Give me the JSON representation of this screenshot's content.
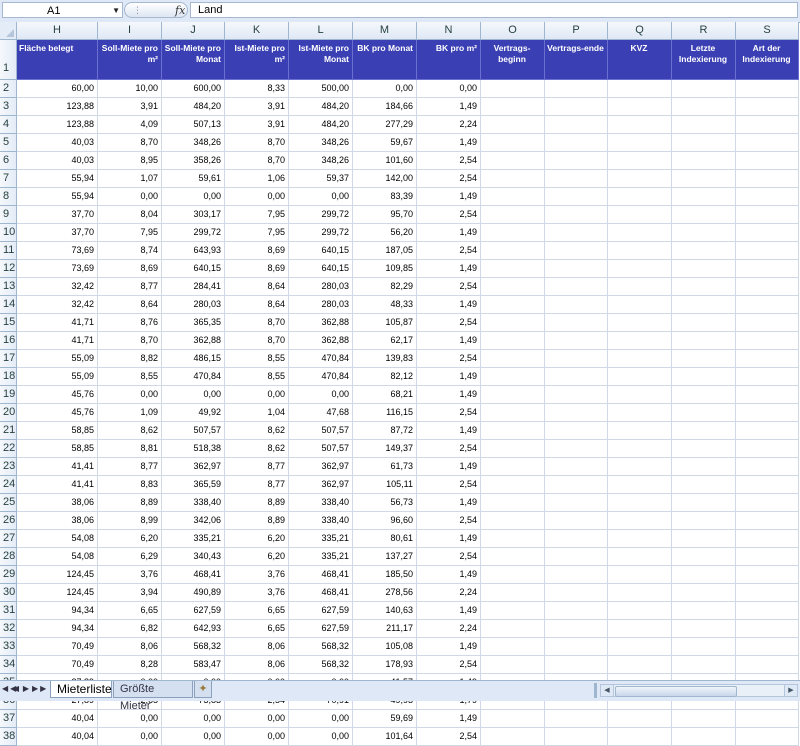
{
  "formula_bar": {
    "name_box": "A1",
    "fx_label": "fx",
    "formula_value": "Land"
  },
  "columns": [
    "H",
    "I",
    "J",
    "K",
    "L",
    "M",
    "N",
    "O",
    "P",
    "Q",
    "R",
    "S"
  ],
  "headers": [
    "Fläche belegt",
    "Soll-Miete pro m²",
    "Soll-Miete pro Monat",
    "Ist-Miete pro m²",
    "Ist-Miete pro Monat",
    "BK pro Monat",
    "BK pro m²",
    "Vertrags-beginn",
    "Vertrags-ende",
    "KVZ",
    "Letzte Indexierung",
    "Art der Indexierung"
  ],
  "first_row_number": 1,
  "rows": [
    [
      "60,00",
      "10,00",
      "600,00",
      "8,33",
      "500,00",
      "0,00",
      "0,00"
    ],
    [
      "123,88",
      "3,91",
      "484,20",
      "3,91",
      "484,20",
      "184,66",
      "1,49"
    ],
    [
      "123,88",
      "4,09",
      "507,13",
      "3,91",
      "484,20",
      "277,29",
      "2,24"
    ],
    [
      "40,03",
      "8,70",
      "348,26",
      "8,70",
      "348,26",
      "59,67",
      "1,49"
    ],
    [
      "40,03",
      "8,95",
      "358,26",
      "8,70",
      "348,26",
      "101,60",
      "2,54"
    ],
    [
      "55,94",
      "1,07",
      "59,61",
      "1,06",
      "59,37",
      "142,00",
      "2,54"
    ],
    [
      "55,94",
      "0,00",
      "0,00",
      "0,00",
      "0,00",
      "83,39",
      "1,49"
    ],
    [
      "37,70",
      "8,04",
      "303,17",
      "7,95",
      "299,72",
      "95,70",
      "2,54"
    ],
    [
      "37,70",
      "7,95",
      "299,72",
      "7,95",
      "299,72",
      "56,20",
      "1,49"
    ],
    [
      "73,69",
      "8,74",
      "643,93",
      "8,69",
      "640,15",
      "187,05",
      "2,54"
    ],
    [
      "73,69",
      "8,69",
      "640,15",
      "8,69",
      "640,15",
      "109,85",
      "1,49"
    ],
    [
      "32,42",
      "8,77",
      "284,41",
      "8,64",
      "280,03",
      "82,29",
      "2,54"
    ],
    [
      "32,42",
      "8,64",
      "280,03",
      "8,64",
      "280,03",
      "48,33",
      "1,49"
    ],
    [
      "41,71",
      "8,76",
      "365,35",
      "8,70",
      "362,88",
      "105,87",
      "2,54"
    ],
    [
      "41,71",
      "8,70",
      "362,88",
      "8,70",
      "362,88",
      "62,17",
      "1,49"
    ],
    [
      "55,09",
      "8,82",
      "486,15",
      "8,55",
      "470,84",
      "139,83",
      "2,54"
    ],
    [
      "55,09",
      "8,55",
      "470,84",
      "8,55",
      "470,84",
      "82,12",
      "1,49"
    ],
    [
      "45,76",
      "0,00",
      "0,00",
      "0,00",
      "0,00",
      "68,21",
      "1,49"
    ],
    [
      "45,76",
      "1,09",
      "49,92",
      "1,04",
      "47,68",
      "116,15",
      "2,54"
    ],
    [
      "58,85",
      "8,62",
      "507,57",
      "8,62",
      "507,57",
      "87,72",
      "1,49"
    ],
    [
      "58,85",
      "8,81",
      "518,38",
      "8,62",
      "507,57",
      "149,37",
      "2,54"
    ],
    [
      "41,41",
      "8,77",
      "362,97",
      "8,77",
      "362,97",
      "61,73",
      "1,49"
    ],
    [
      "41,41",
      "8,83",
      "365,59",
      "8,77",
      "362,97",
      "105,11",
      "2,54"
    ],
    [
      "38,06",
      "8,89",
      "338,40",
      "8,89",
      "338,40",
      "56,73",
      "1,49"
    ],
    [
      "38,06",
      "8,99",
      "342,06",
      "8,89",
      "338,40",
      "96,60",
      "2,54"
    ],
    [
      "54,08",
      "6,20",
      "335,21",
      "6,20",
      "335,21",
      "80,61",
      "1,49"
    ],
    [
      "54,08",
      "6,29",
      "340,43",
      "6,20",
      "335,21",
      "137,27",
      "2,54"
    ],
    [
      "124,45",
      "3,76",
      "468,41",
      "3,76",
      "468,41",
      "185,50",
      "1,49"
    ],
    [
      "124,45",
      "3,94",
      "490,89",
      "3,76",
      "468,41",
      "278,56",
      "2,24"
    ],
    [
      "94,34",
      "6,65",
      "627,59",
      "6,65",
      "627,59",
      "140,63",
      "1,49"
    ],
    [
      "94,34",
      "6,82",
      "642,93",
      "6,65",
      "627,59",
      "211,17",
      "2,24"
    ],
    [
      "70,49",
      "8,06",
      "568,32",
      "8,06",
      "568,32",
      "105,08",
      "1,49"
    ],
    [
      "70,49",
      "8,28",
      "583,47",
      "8,06",
      "568,32",
      "178,93",
      "2,54"
    ],
    [
      "27,89",
      "0,00",
      "0,00",
      "0,00",
      "0,00",
      "41,57",
      "1,49"
    ],
    [
      "27,89",
      "2,65",
      "73,83",
      "2,54",
      "70,91",
      "49,93",
      "1,79"
    ],
    [
      "40,04",
      "0,00",
      "0,00",
      "0,00",
      "0,00",
      "59,69",
      "1,49"
    ],
    [
      "40,04",
      "0,00",
      "0,00",
      "0,00",
      "0,00",
      "101,64",
      "2,54"
    ]
  ],
  "sheet_tabs": [
    {
      "label": "Mieterliste",
      "active": true
    },
    {
      "label": "Größte Mieter",
      "active": false
    }
  ],
  "nav_buttons": [
    "◀◀",
    "◀",
    "▶",
    "▶▶"
  ],
  "colors": {
    "header_fill": "#3a3fb3",
    "header_text": "#ffffff",
    "chrome": "#dfe8f6"
  }
}
